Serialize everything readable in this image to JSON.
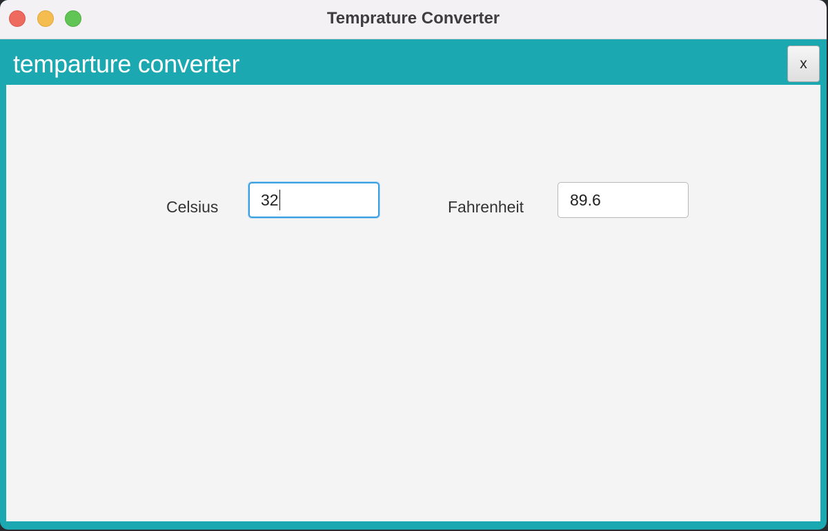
{
  "window": {
    "title": "Temprature Converter"
  },
  "header": {
    "title": "temparture converter",
    "close_label": "x"
  },
  "form": {
    "celsius_label": "Celsius",
    "celsius_value": "32",
    "fahrenheit_label": "Fahrenheit",
    "fahrenheit_value": "89.6"
  },
  "colors": {
    "accent": "#1ba8b0",
    "focus": "#3a9fe0"
  }
}
